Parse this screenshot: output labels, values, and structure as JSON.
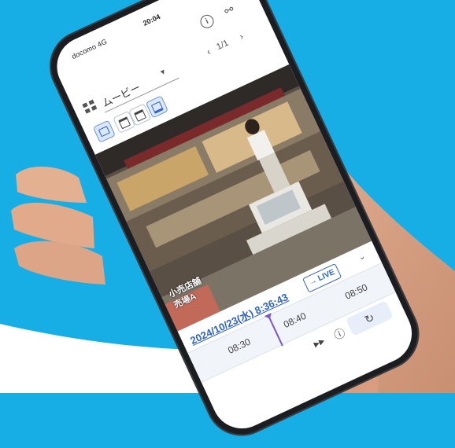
{
  "colors": {
    "background": "#17aee6",
    "accent": "#2f63c9",
    "playhead": "#7c57c9"
  },
  "statusbar": {
    "carrier": "docomo 4G",
    "time": "20:04"
  },
  "appbar": {
    "info_icon": "info-icon",
    "share_icon": "share-icon"
  },
  "selector": {
    "label": "ムービー",
    "pager": "1/1"
  },
  "layouts": [
    "single",
    "split-2",
    "split-4",
    "fit"
  ],
  "video": {
    "label_line1": "小売店舗",
    "label_line2": "売場A"
  },
  "timebar": {
    "datetime": "2024/10/23(水) 8:36:43",
    "live_label": "LIVE",
    "ticks": [
      "08:30",
      "08:40",
      "08:50"
    ]
  }
}
